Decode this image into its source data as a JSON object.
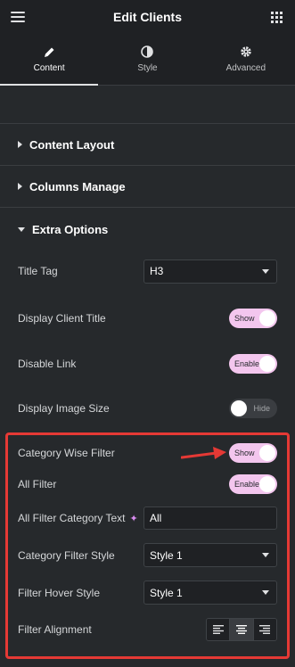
{
  "header": {
    "title": "Edit Clients",
    "menu_icon": "hamburger-icon",
    "apps_icon": "grid-icon"
  },
  "tabs": [
    {
      "label": "Content",
      "icon": "pencil-icon",
      "active": true
    },
    {
      "label": "Style",
      "icon": "half-circle-icon",
      "active": false
    },
    {
      "label": "Advanced",
      "icon": "gear-icon",
      "active": false
    }
  ],
  "sections": {
    "content_layout": "Content Layout",
    "columns_manage": "Columns Manage",
    "extra_options": "Extra Options"
  },
  "fields": {
    "title_tag": {
      "label": "Title Tag",
      "value": "H3"
    },
    "display_client_title": {
      "label": "Display Client Title",
      "state": "Show"
    },
    "disable_link": {
      "label": "Disable Link",
      "state": "Enable"
    },
    "display_image_size": {
      "label": "Display Image Size",
      "state": "Hide"
    },
    "category_wise_filter": {
      "label": "Category Wise Filter",
      "state": "Show"
    },
    "all_filter": {
      "label": "All Filter",
      "state": "Enable"
    },
    "all_filter_category_text": {
      "label": "All Filter Category Text",
      "value": "All"
    },
    "category_filter_style": {
      "label": "Category Filter Style",
      "value": "Style 1"
    },
    "filter_hover_style": {
      "label": "Filter Hover Style",
      "value": "Style 1"
    },
    "filter_alignment": {
      "label": "Filter Alignment",
      "options": [
        "align-left-icon",
        "align-center-icon",
        "align-right-icon"
      ],
      "selected": "align-center-icon"
    }
  },
  "colors": {
    "toggle_on": "#f3c6ee",
    "highlight": "#e53935",
    "panel": "#26292c",
    "header": "#1f2124"
  }
}
